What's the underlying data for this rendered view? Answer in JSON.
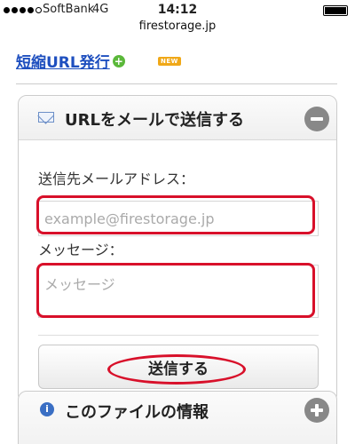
{
  "status_bar": {
    "signal_bars": 4,
    "signal_max": 5,
    "carrier": "SoftBank",
    "network": "4G",
    "time": "14:12",
    "battery_level": 1.0
  },
  "browser": {
    "url": "firestorage.jp"
  },
  "short_url": {
    "link_label": "短縮URL発行",
    "plus_icon": "plus-circle-green-icon",
    "badge": "NEW"
  },
  "mail_panel": {
    "icon": "envelope-icon",
    "title": "URLをメールで送信する",
    "collapse_icon": "minus-circle-icon",
    "email_label": "送信先メールアドレス：",
    "email_placeholder": "example@firestorage.jp",
    "email_value": "",
    "message_label": "メッセージ：",
    "message_placeholder": "メッセージ",
    "message_value": "",
    "submit_label": "送信する"
  },
  "info_panel": {
    "icon": "info-icon",
    "title": "このファイルの情報",
    "expand_icon": "plus-circle-icon"
  },
  "colors": {
    "link": "#1e4fbf",
    "annotation_red": "#d8102a",
    "badge_orange": "#f0a818",
    "plus_green": "#5bb83a",
    "info_blue": "#3a6fc4"
  }
}
